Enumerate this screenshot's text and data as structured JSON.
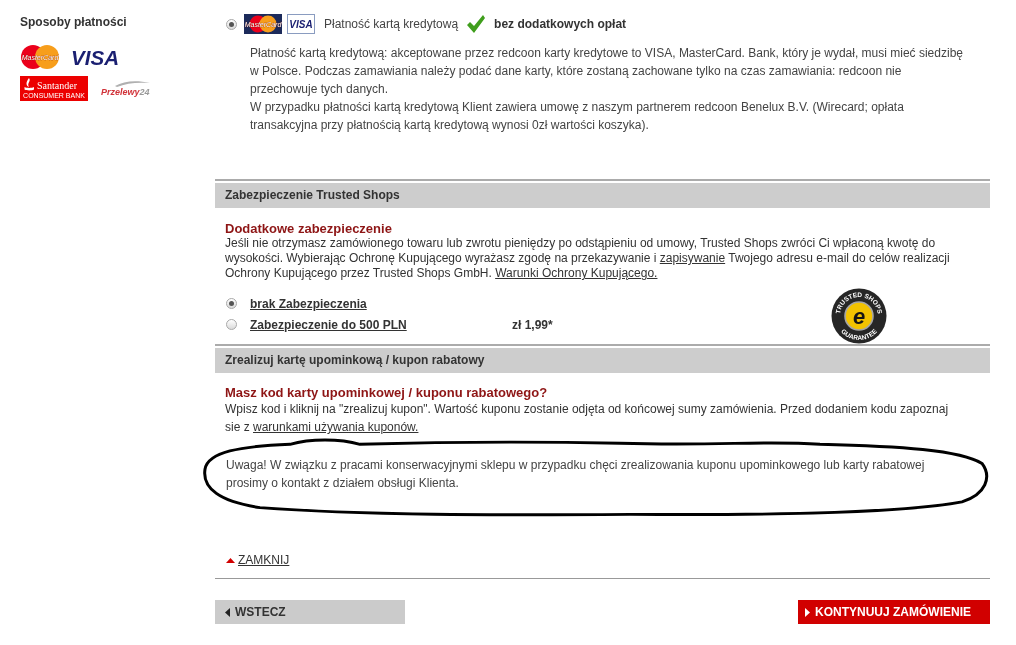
{
  "sidebar": {
    "title": "Sposoby płatności",
    "logos": [
      {
        "kind": "mastercard",
        "text": "MasterCard"
      },
      {
        "kind": "visa",
        "text": "VISA"
      },
      {
        "kind": "santander",
        "text": "Santander",
        "subtext": "CONSUMER BANK"
      },
      {
        "kind": "przelewy24",
        "text": "Przelewy",
        "suffix": "24"
      }
    ]
  },
  "payment_method": {
    "selected": true,
    "logos": [
      {
        "kind": "mastercard",
        "text": "MasterCard"
      },
      {
        "kind": "visa",
        "text": "VISA"
      }
    ],
    "label": "Płatność kartą kredytową",
    "fee_note": "bez dodatkowych opłat",
    "description": [
      "Płatność kartą kredytową: akceptowane przez redcoon karty kredytowe to VISA, MasterCard. Bank, który je wydał, musi mieć siedzibę w Polsce. Podczas zamawiania należy podać dane karty, które zostaną zachowane tylko na czas zamawiania: redcoon nie przechowuje tych danych.",
      "W przypadku płatności kartą kredytową Klient zawiera umowę z naszym partnerem redcoon Benelux B.V. (Wirecard; opłata transakcyjna przy płatnością kartą kredytową wynosi 0zł wartości koszyka)."
    ]
  },
  "trusted_shops": {
    "header": "Zabezpieczenie Trusted Shops",
    "title": "Dodatkowe zabezpieczenie",
    "text": [
      {
        "kind": "text",
        "text": "Jeśli nie otrzymasz zamówionego towaru lub zwrotu pieniędzy po odstąpieniu od umowy, Trusted Shops zwróci Ci wpłaconą kwotę do wysokości. Wybierając Ochronę Kupującego wyrażasz zgodę na przekazywanie i "
      },
      {
        "kind": "link",
        "text": "zapisywanie"
      },
      {
        "kind": "text",
        "text": " Twojego adresu e-mail do celów realizacji Ochrony Kupującego przez Trusted Shops GmbH. "
      },
      {
        "kind": "link",
        "text": "Warunki Ochrony Kupującego."
      }
    ],
    "options": [
      {
        "label": "brak Zabezpieczenia",
        "selected": true
      },
      {
        "label": "Zabezpieczenie do 500 PLN",
        "selected": false,
        "price": "zł 1,99*"
      }
    ],
    "seal": {
      "top": "TRUSTED SHOPS",
      "bottom": "GUARANTEE",
      "letter": "e"
    }
  },
  "coupon": {
    "header": "Zrealizuj kartę upominkową / kupon rabatowy",
    "title": "Masz kod karty upominkowej / kuponu rabatowego?",
    "text": [
      {
        "kind": "text",
        "text": "Wpisz kod i kliknij na \"zrealizuj kupon\". Wartość kuponu zostanie odjęta od końcowej sumy zamówienia. Przed dodaniem kodu zapoznaj sie z "
      },
      {
        "kind": "link",
        "text": "warunkami używania kuponów."
      }
    ],
    "notice": "Uwaga! W związku z pracami konserwacyjnymi sklepu w przypadku chęci zrealizowania kuponu upominkowego lub karty rabatowej prosimy o kontakt z działem obsługi Klienta."
  },
  "close_link": "ZAMKNIJ",
  "buttons": [
    {
      "kind": "back",
      "label": "WSTECZ"
    },
    {
      "kind": "continue",
      "label": "KONTYNUUJ ZAMÓWIENIE"
    }
  ]
}
